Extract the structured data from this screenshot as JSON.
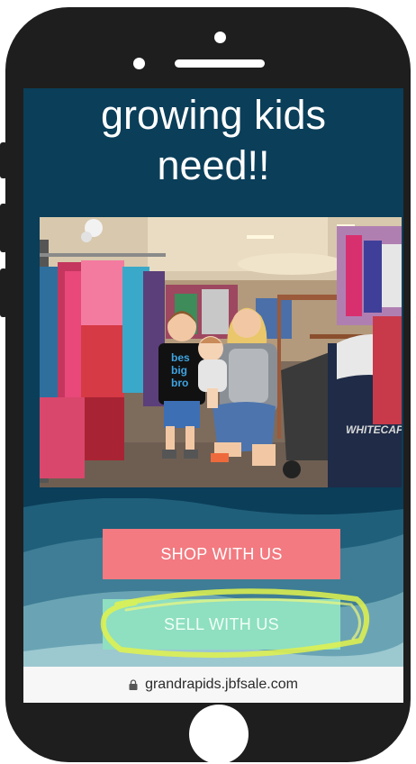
{
  "headline": {
    "line1": "growing kids",
    "line2": "need!!"
  },
  "photo": {
    "shirt_text": "bes big bro",
    "jersey_text": "WHITECAPS"
  },
  "buttons": {
    "shop_label": "SHOP WITH US",
    "sell_label": "SELL WITH US"
  },
  "url_bar": {
    "url": "grandrapids.jbfsale.com",
    "icon": "lock-icon"
  },
  "colors": {
    "screen_bg": "#0b3e59",
    "shop_button": "#f27a80",
    "sell_button": "#8fdfc1",
    "highlight": "#e8f54a"
  }
}
